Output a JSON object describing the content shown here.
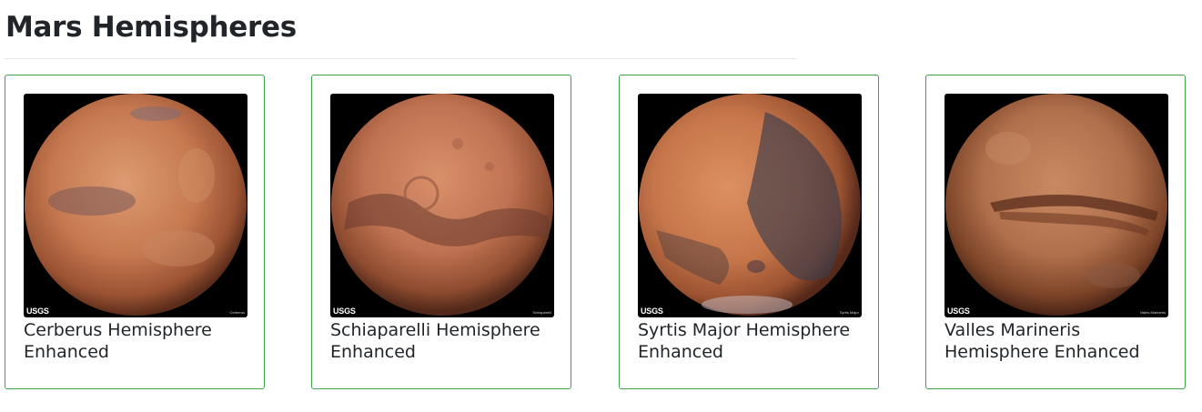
{
  "page": {
    "title": "Mars Hemispheres"
  },
  "hemispheres": [
    {
      "title": "Cerberus Hemisphere Enhanced",
      "image_icon": "mars-globe-cerberus",
      "usgs_label": "USGS",
      "image_caption": "Cerberus"
    },
    {
      "title": "Schiaparelli Hemisphere Enhanced",
      "image_icon": "mars-globe-schiaparelli",
      "usgs_label": "USGS",
      "image_caption": "Schiaparelli"
    },
    {
      "title": "Syrtis Major Hemisphere Enhanced",
      "image_icon": "mars-globe-syrtis-major",
      "usgs_label": "USGS",
      "image_caption": "Syrtis Major"
    },
    {
      "title": "Valles Marineris Hemisphere Enhanced",
      "image_icon": "mars-globe-valles-marineris",
      "usgs_label": "USGS",
      "image_caption": "Valles Marineris"
    }
  ],
  "colors": {
    "card_border": "#3fa34d",
    "mars_light": "#d98a5c",
    "mars_mid": "#b8653d",
    "mars_dark": "#6b3a26"
  }
}
